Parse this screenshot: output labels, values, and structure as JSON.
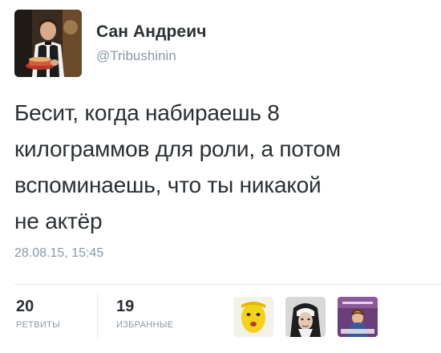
{
  "author": {
    "name": "Сан Андреич",
    "handle": "@Tribushinin"
  },
  "tweet": {
    "lines": [
      "Бесит, когда набираешь 8",
      "килограммов для роли, а потом",
      "вспоминаешь, что ты никакой",
      "не актёр"
    ],
    "timestamp": "28.08.15, 15:45"
  },
  "stats": {
    "retweets": {
      "count": "20",
      "label": "РЕТВИТЫ"
    },
    "favorites": {
      "count": "19",
      "label": "ИЗБРАННЫЕ"
    }
  },
  "favoriters": [
    {
      "icon": "yellow-face-avatar-icon"
    },
    {
      "icon": "nun-avatar-icon"
    },
    {
      "icon": "meme-avatar-icon"
    }
  ]
}
